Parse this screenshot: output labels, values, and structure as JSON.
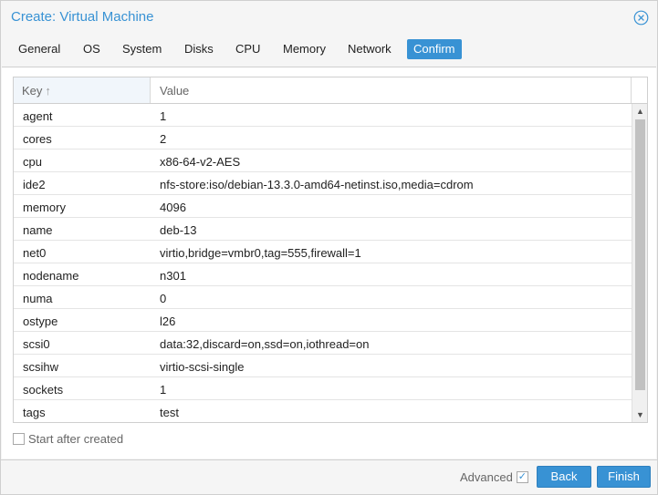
{
  "window": {
    "title": "Create: Virtual Machine"
  },
  "tabs": [
    {
      "label": "General",
      "active": false
    },
    {
      "label": "OS",
      "active": false
    },
    {
      "label": "System",
      "active": false
    },
    {
      "label": "Disks",
      "active": false
    },
    {
      "label": "CPU",
      "active": false
    },
    {
      "label": "Memory",
      "active": false
    },
    {
      "label": "Network",
      "active": false
    },
    {
      "label": "Confirm",
      "active": true
    }
  ],
  "grid": {
    "columns": {
      "key": "Key",
      "value": "Value"
    },
    "sort_icon": "arrow-up",
    "rows": [
      {
        "key": "agent",
        "value": "1"
      },
      {
        "key": "cores",
        "value": "2"
      },
      {
        "key": "cpu",
        "value": "x86-64-v2-AES"
      },
      {
        "key": "ide2",
        "value": "nfs-store:iso/debian-13.3.0-amd64-netinst.iso,media=cdrom"
      },
      {
        "key": "memory",
        "value": "4096"
      },
      {
        "key": "name",
        "value": "deb-13"
      },
      {
        "key": "net0",
        "value": "virtio,bridge=vmbr0,tag=555,firewall=1"
      },
      {
        "key": "nodename",
        "value": "n301"
      },
      {
        "key": "numa",
        "value": "0"
      },
      {
        "key": "ostype",
        "value": "l26"
      },
      {
        "key": "scsi0",
        "value": "data:32,discard=on,ssd=on,iothread=on"
      },
      {
        "key": "scsihw",
        "value": "virtio-scsi-single"
      },
      {
        "key": "sockets",
        "value": "1"
      },
      {
        "key": "tags",
        "value": "test"
      }
    ]
  },
  "options": {
    "start_after_created": {
      "label": "Start after created",
      "checked": false
    }
  },
  "footer": {
    "advanced": {
      "label": "Advanced",
      "checked": true
    },
    "back_label": "Back",
    "finish_label": "Finish"
  },
  "colors": {
    "accent": "#3892d4",
    "header_bg": "#f5f5f5",
    "key_header_bg": "#f1f6fb"
  }
}
